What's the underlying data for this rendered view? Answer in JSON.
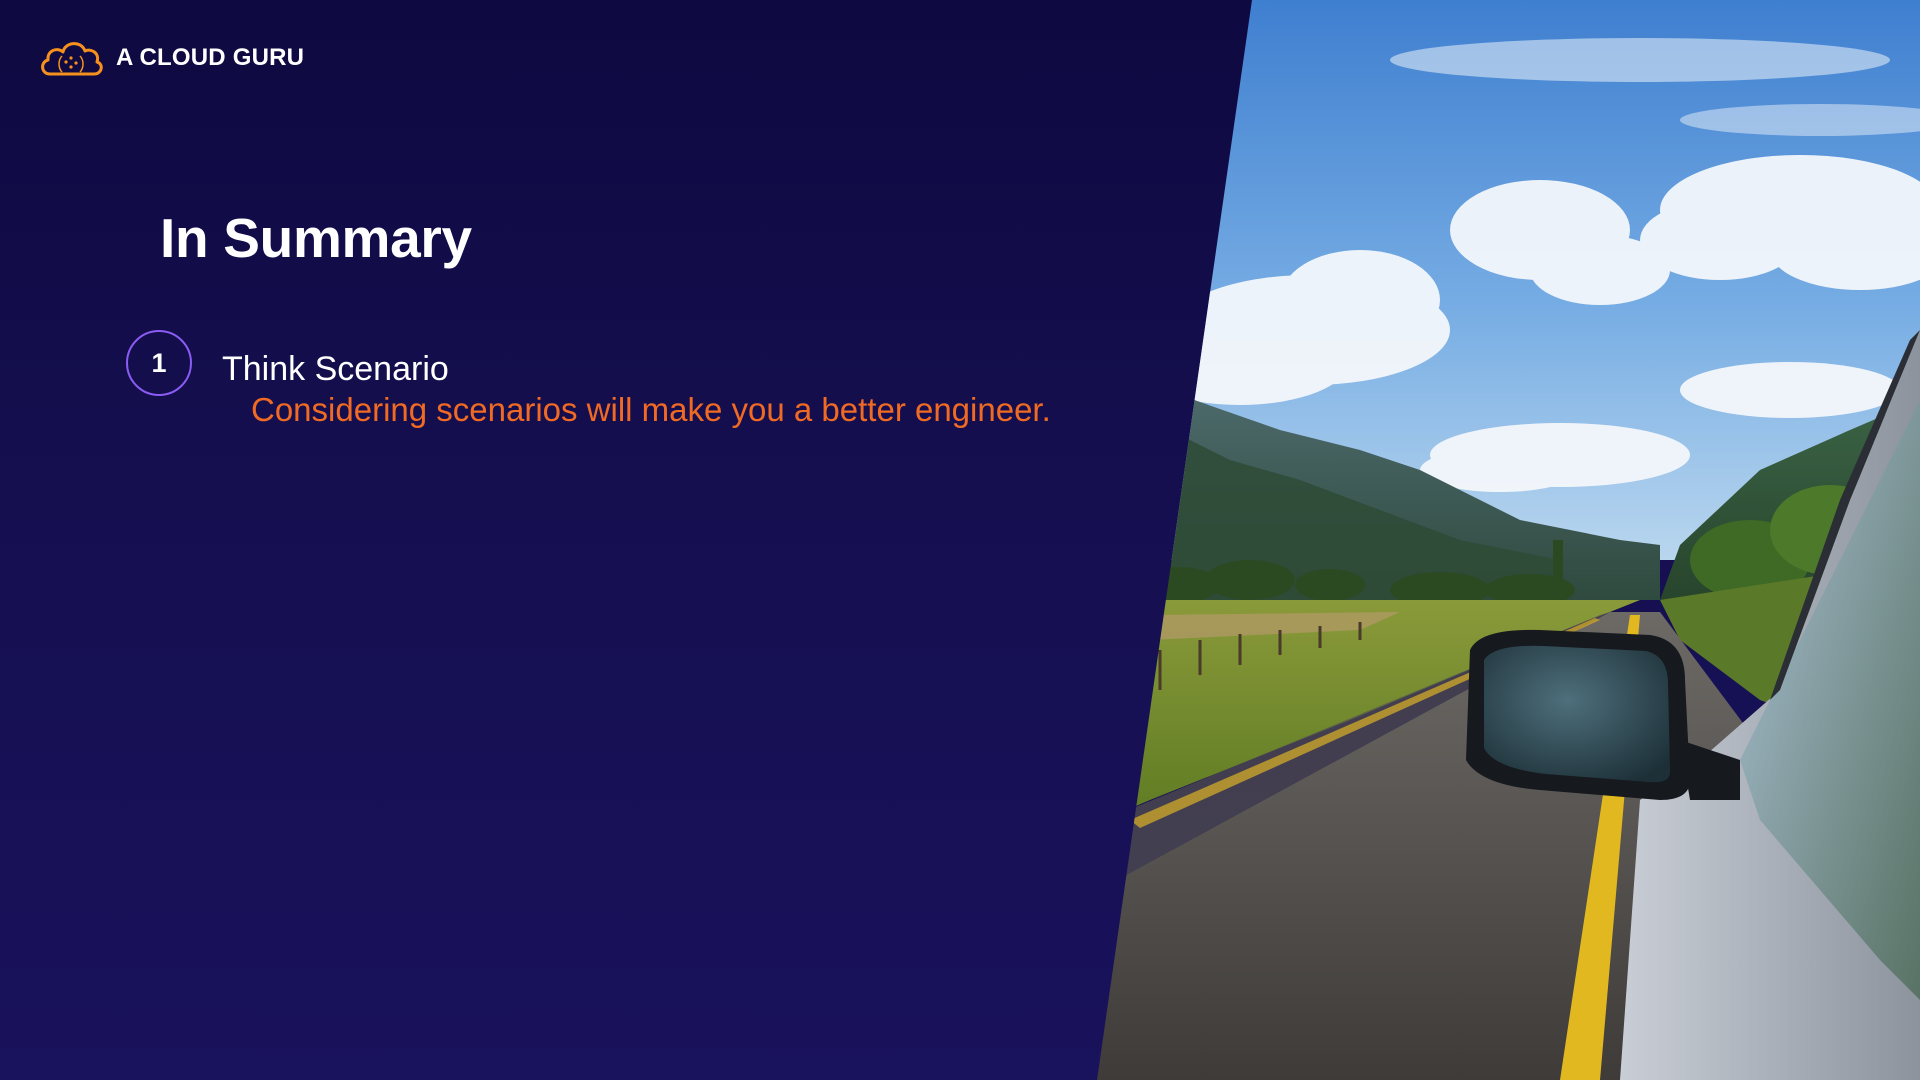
{
  "brand": {
    "name": "A CLOUD GURU",
    "icon": "cloud-logo-icon",
    "logo_color": "#f6911e"
  },
  "slide": {
    "title": "In Summary",
    "items": [
      {
        "number": "1",
        "title": "Think Scenario",
        "description": "Considering scenarios will make you a better engineer."
      }
    ]
  },
  "photo": {
    "subject": "car-side-mirror-road-photo"
  },
  "colors": {
    "background": "#16104f",
    "accent_orange": "#f06a24",
    "accent_purple": "#8a5cf2",
    "text": "#ffffff"
  }
}
